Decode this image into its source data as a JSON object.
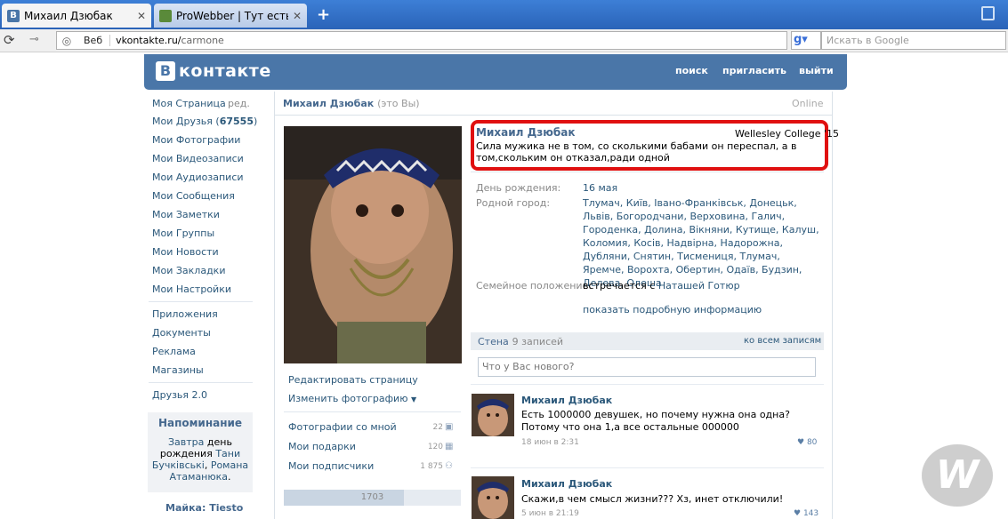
{
  "browser": {
    "tabs": [
      {
        "title": "Михаил Дзюбак"
      },
      {
        "title": "ProWebber | Тут есть в..."
      }
    ],
    "address_label": "Веб",
    "url_host": "vkontakte.ru/",
    "url_path": "carmone",
    "search_placeholder": "Искать в Google"
  },
  "vk": {
    "logo": "контакте",
    "logo_letter": "В",
    "nav": [
      "поиск",
      "пригласить",
      "выйти"
    ]
  },
  "menu": {
    "my_page": "Моя Страница",
    "edit": "ред.",
    "friends": "Мои Друзья",
    "friends_count": "67555",
    "items": [
      "Мои Фотографии",
      "Мои Видеозаписи",
      "Мои Аудиозаписи",
      "Мои Сообщения",
      "Мои Заметки",
      "Мои Группы",
      "Мои Новости",
      "Мои Закладки",
      "Мои Настройки"
    ],
    "extra": [
      "Приложения",
      "Документы",
      "Реклама",
      "Магазины"
    ],
    "friends2": "Друзья 2.0",
    "reminder_title": "Напоминание",
    "reminder_pre": "Завтра",
    "reminder_mid": "день рождения",
    "reminder_name1": "Тани Бучківські",
    "reminder_comma": ",",
    "reminder_name2": "Романа Атаманюка",
    "reminder_end": ".",
    "mayka": "Майка: Tiesto"
  },
  "profile": {
    "header_name": "Михаил Дзюбак",
    "header_you": "(это Вы)",
    "online": "Online",
    "edit_page": "Редактировать страницу",
    "change_photo": "Изменить фотографию",
    "photos_with_me": "Фотографии со мной",
    "photos_with_me_count": "22",
    "gifts": "Мои подарки",
    "gifts_count": "120",
    "subscribers": "Мои подписчики",
    "subscribers_count": "1 875",
    "rating": "1703",
    "rating_fill": 0.68,
    "full_name": "Михаил Дзюбак",
    "college": "Wellesley College '15",
    "status": "Сила мужика не в том, со сколькими бабами он переспал, а в том,скольким он отказал,ради одной",
    "birthday_label": "День рождения:",
    "birthday": "16 мая",
    "hometown_label": "Родной город:",
    "hometown": "Тлумач, Київ, Івано-Франківськ, Донецьк, Львів, Богородчани, Верховина, Галич, Городенка, Долина, Вікняни, Кутище, Калуш, Коломия, Косів, Надвірна, Надорожна, Дубляни, Снятин, Тисмениця, Тлумач, Яремче, Ворохта, Обертин, Одаїв, Будзин, Делева, Олеша",
    "family_label": "Семейное положение:",
    "family_pre": "встречается с",
    "family_link": "Наташей Готюр",
    "show_more": "показать подробную информацию"
  },
  "wall": {
    "title": "Стена",
    "count": "9 записей",
    "all": "ко всем записям",
    "input_placeholder": "Что у Вас нового?",
    "posts": [
      {
        "author": "Михаил Дзюбак",
        "text": "Есть 1000000 девушек, но почему нужна она одна? Потому что она 1,а все остальные 000000",
        "date": "18 июн в 2:31",
        "likes": "80"
      },
      {
        "author": "Михаил Дзюбак",
        "text": "Скажи,в чем смысл жизни??? Хз, инет отключили!",
        "date": "5 июн в 21:19",
        "likes": "143"
      }
    ]
  },
  "watermark": "W"
}
